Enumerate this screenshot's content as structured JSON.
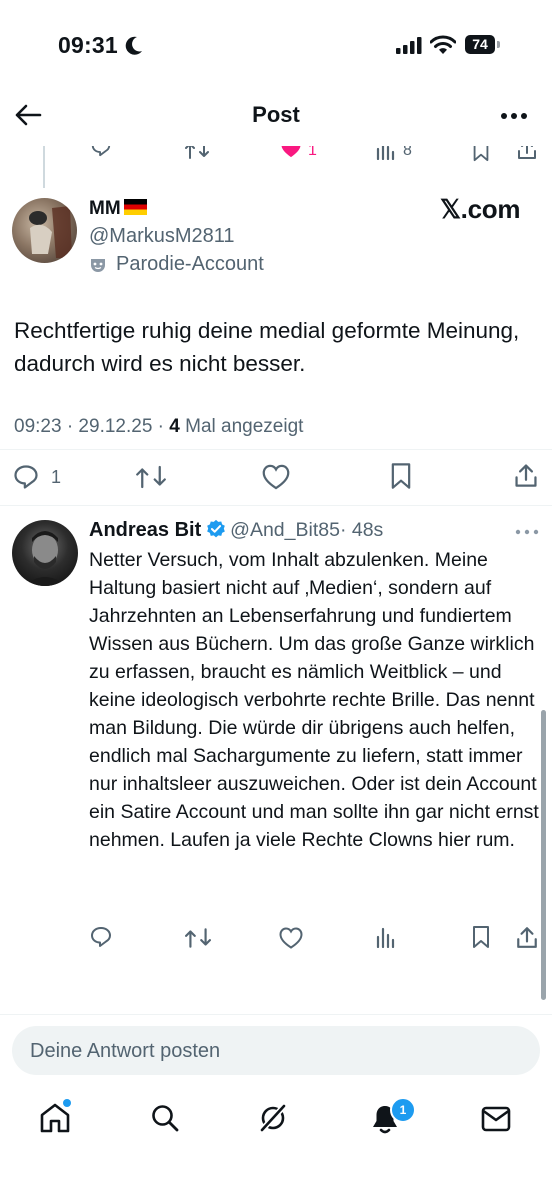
{
  "status_bar": {
    "time": "09:31",
    "battery": "74"
  },
  "header": {
    "title": "Post"
  },
  "parent_actions": {
    "likes": "1",
    "views": "8"
  },
  "tweet": {
    "name": "MM",
    "flag": "🇩🇪",
    "handle": "@MarkusM2811",
    "label": "Parodie-Account",
    "brand": "𝕏.com",
    "text": "Rechtfertige ruhig deine medial geformte Meinung, dadurch wird es nicht besser.",
    "time_date": "09:23 · 29.12.25 · ",
    "views_count": "4",
    "views_label": " Mal angezeigt",
    "reply_count": "1"
  },
  "reply": {
    "name": "Andreas Bit",
    "handle": "@And_Bit85",
    "age": "· 48s",
    "text": "Netter Versuch, vom Inhalt abzulenken. Meine Haltung basiert nicht auf ‚Medien‘, sondern auf Jahrzehnten an Lebenserfahrung und fundiertem Wissen aus Büchern. Um das große Ganze wirklich zu erfassen, braucht es nämlich Weitblick – und keine ideologisch verbohrte rechte Brille. Das nennt man Bildung. Die würde dir übrigens auch helfen, endlich mal Sachargumente zu liefern, statt immer nur inhaltsleer auszuweichen. Oder ist dein Account ein Satire Account und man sollte ihn gar nicht ernst nehmen. Laufen ja viele Rechte Clowns hier rum."
  },
  "composer": {
    "placeholder": "Deine Antwort posten"
  },
  "bottom_nav": {
    "notifications_badge": "1"
  },
  "colors": {
    "accent": "#1d9bf0",
    "like": "#f91880",
    "text": "#0f1419",
    "muted": "#536471"
  }
}
